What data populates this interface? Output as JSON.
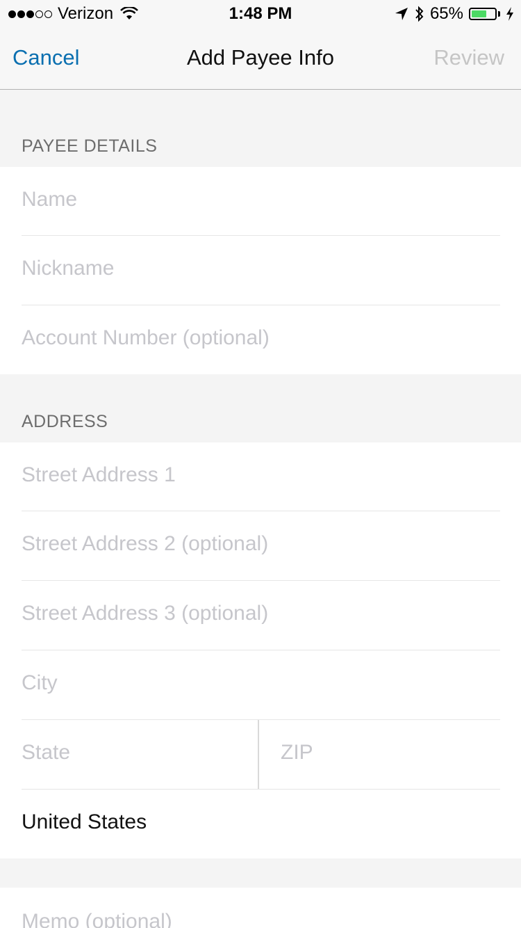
{
  "status_bar": {
    "carrier": "Verizon",
    "time": "1:48 PM",
    "battery_percent": "65%",
    "battery_level": 0.65,
    "signal_filled": 3,
    "signal_total": 5
  },
  "nav": {
    "cancel_label": "Cancel",
    "title": "Add Payee Info",
    "review_label": "Review"
  },
  "payee_details": {
    "header": "PAYEE DETAILS",
    "name_placeholder": "Name",
    "nickname_placeholder": "Nickname",
    "account_placeholder": "Account Number (optional)"
  },
  "address": {
    "header": "ADDRESS",
    "street1_placeholder": "Street Address 1",
    "street2_placeholder": "Street Address 2 (optional)",
    "street3_placeholder": "Street Address 3 (optional)",
    "city_placeholder": "City",
    "state_placeholder": "State",
    "zip_placeholder": "ZIP",
    "country_value": "United States"
  },
  "memo": {
    "memo_placeholder": "Memo (optional)"
  },
  "colors": {
    "accent": "#0a6fb0",
    "placeholder": "#c6c6cb",
    "battery_green": "#4cd964"
  }
}
